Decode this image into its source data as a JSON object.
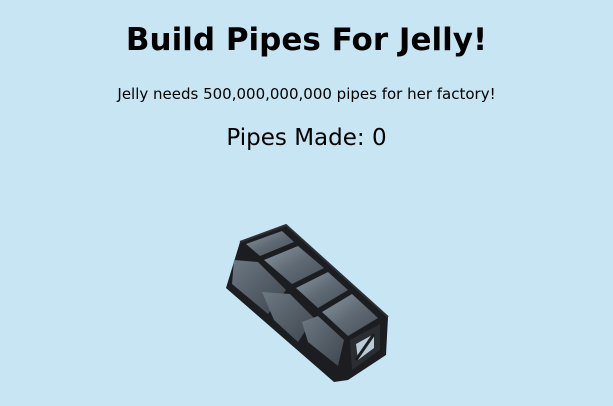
{
  "game": {
    "title": "Build Pipes For Jelly!",
    "subtitle": "Jelly needs 500,000,000,000 pipes for her factory!",
    "counter_label": "Pipes Made: ",
    "counter_value": "0",
    "pipe_icon": "pipe-icon"
  },
  "colors": {
    "background": "#c7e5f3",
    "frame": "#1c1e21",
    "panel_light": "#6f7b85",
    "panel_dark": "#4a5159"
  }
}
